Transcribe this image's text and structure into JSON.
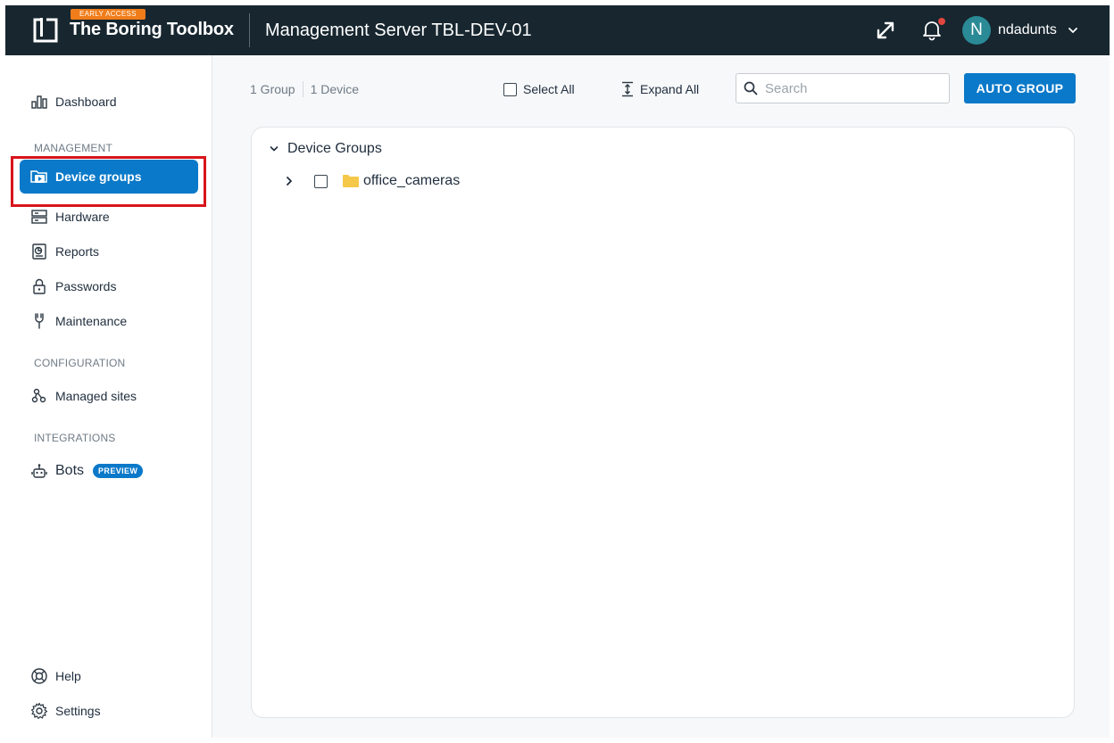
{
  "header": {
    "badge": "EARLY ACCESS",
    "brand": "The Boring Toolbox",
    "server_title": "Management Server TBL-DEV-01",
    "user": {
      "initial": "N",
      "name": "ndadunts"
    },
    "notification_dot_color": "#e0463f",
    "bg_color": "#17262f"
  },
  "sidebar": {
    "top_items": [
      {
        "label": "Dashboard",
        "icon": "bar-chart-icon"
      }
    ],
    "sections": [
      {
        "title": "MANAGEMENT",
        "items": [
          {
            "label": "Device groups",
            "icon": "folder-play-icon",
            "active": true
          },
          {
            "label": "Hardware",
            "icon": "server-icon"
          },
          {
            "label": "Reports",
            "icon": "report-icon"
          },
          {
            "label": "Passwords",
            "icon": "lock-icon"
          },
          {
            "label": "Maintenance",
            "icon": "wrench-icon"
          }
        ]
      },
      {
        "title": "CONFIGURATION",
        "items": [
          {
            "label": "Managed sites",
            "icon": "sites-icon"
          }
        ]
      },
      {
        "title": "INTEGRATIONS",
        "items": [
          {
            "label": "Bots",
            "icon": "robot-icon",
            "badge": "PREVIEW"
          }
        ]
      }
    ],
    "bottom_items": [
      {
        "label": "Help",
        "icon": "lifebuoy-icon"
      },
      {
        "label": "Settings",
        "icon": "gear-icon"
      }
    ],
    "accent_color": "#0b79c9"
  },
  "toolbar": {
    "group_count": "1 Group",
    "device_count": "1 Device",
    "select_all": "Select All",
    "expand_all": "Expand All",
    "search_placeholder": "Search",
    "search_value": "",
    "auto_group": "AUTO GROUP"
  },
  "tree": {
    "root_label": "Device Groups",
    "root_expanded": true,
    "groups": [
      {
        "label": "office_cameras",
        "checked": false,
        "expanded": false
      }
    ],
    "folder_color": "#f6c84a"
  }
}
